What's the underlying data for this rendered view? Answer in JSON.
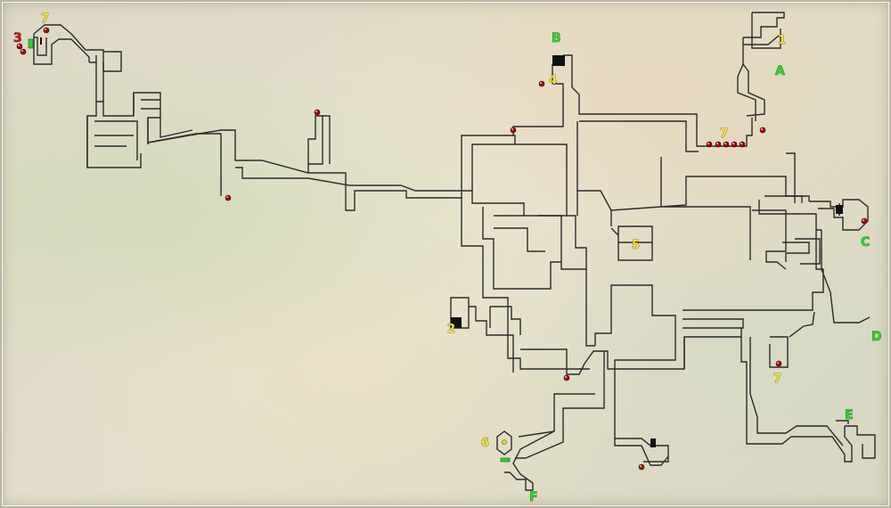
{
  "map": {
    "markers": [
      {
        "id": "m-3",
        "text": "3",
        "kind": "red"
      },
      {
        "id": "m-7a",
        "text": "7",
        "kind": "num"
      },
      {
        "id": "m-B",
        "text": "B",
        "kind": "letter"
      },
      {
        "id": "m-4",
        "text": "4",
        "kind": "num"
      },
      {
        "id": "m-1",
        "text": "1",
        "kind": "num"
      },
      {
        "id": "m-A",
        "text": "A",
        "kind": "letter"
      },
      {
        "id": "m-7b",
        "text": "7",
        "kind": "num"
      },
      {
        "id": "m-5",
        "text": "5",
        "kind": "num"
      },
      {
        "id": "m-C",
        "text": "C",
        "kind": "letter"
      },
      {
        "id": "m-2",
        "text": "2",
        "kind": "num"
      },
      {
        "id": "m-D",
        "text": "D",
        "kind": "letter"
      },
      {
        "id": "m-7c",
        "text": "7",
        "kind": "num"
      },
      {
        "id": "m-E",
        "text": "E",
        "kind": "letter"
      },
      {
        "id": "m-6",
        "text": "6",
        "kind": "num"
      },
      {
        "id": "m-F",
        "text": "F",
        "kind": "letter"
      }
    ],
    "colors": {
      "wall": "#2b2b2b",
      "item_dot": "#a50d0d",
      "number_label": "#f3e23a",
      "exit_label": "#2fd52f",
      "special_label": "#c81818",
      "door_marker": "#33cc33"
    }
  }
}
